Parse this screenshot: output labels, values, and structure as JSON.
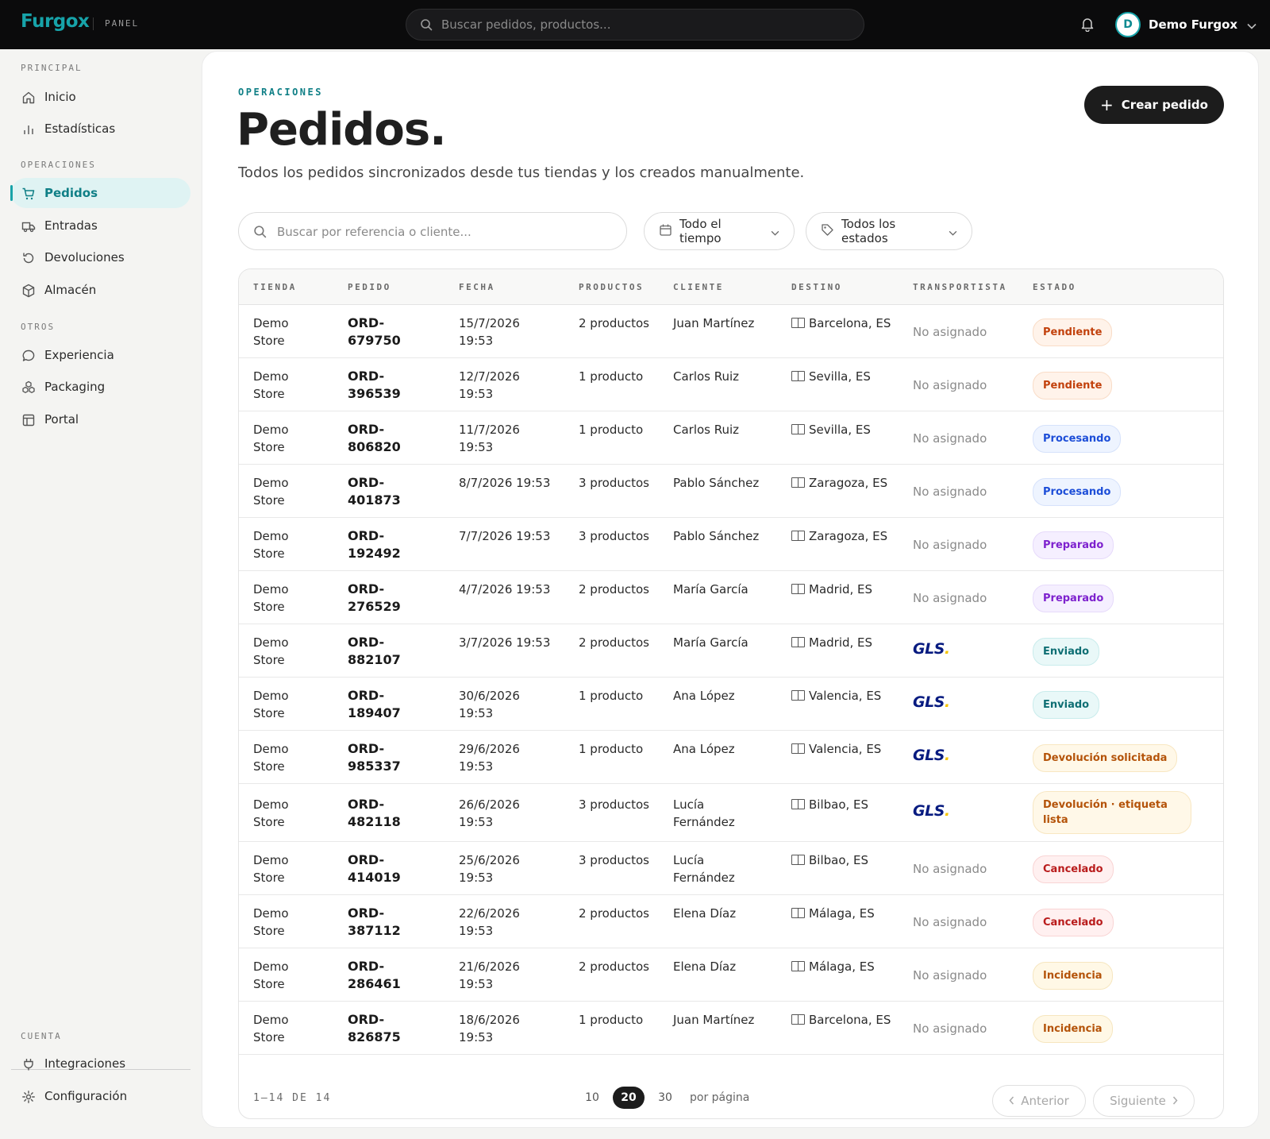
{
  "topbar": {
    "logo": "Furgox",
    "panel_label": "PANEL",
    "search_placeholder": "Buscar pedidos, productos...",
    "user_initial": "D",
    "user_name": "Demo Furgox"
  },
  "sidebar": {
    "sections": {
      "principal": "PRINCIPAL",
      "operaciones": "OPERACIONES",
      "otros": "OTROS",
      "cuenta": "CUENTA"
    },
    "items": [
      {
        "label": "Inicio",
        "icon": "home-icon"
      },
      {
        "label": "Estadísticas",
        "icon": "bar-chart-icon"
      },
      {
        "label": "Pedidos",
        "icon": "cart-icon",
        "active": true
      },
      {
        "label": "Entradas",
        "icon": "truck-icon"
      },
      {
        "label": "Devoluciones",
        "icon": "return-icon"
      },
      {
        "label": "Almacén",
        "icon": "box-icon"
      },
      {
        "label": "Experiencia",
        "icon": "chat-icon"
      },
      {
        "label": "Packaging",
        "icon": "boxes-icon"
      },
      {
        "label": "Portal",
        "icon": "layout-icon"
      },
      {
        "label": "Integraciones",
        "icon": "plug-icon"
      },
      {
        "label": "Configuración",
        "icon": "gear-icon"
      }
    ]
  },
  "page": {
    "eyebrow": "OPERACIONES",
    "title": "Pedidos.",
    "subtitle": "Todos los pedidos sincronizados desde tus tiendas y los creados manualmente.",
    "create_button": "Crear pedido"
  },
  "filters": {
    "search_placeholder": "Buscar por referencia o cliente...",
    "date_filter": "Todo el tiempo",
    "status_filter": "Todos los estados"
  },
  "table": {
    "headers": [
      "TIENDA",
      "PEDIDO",
      "FECHA",
      "PRODUCTOS",
      "CLIENTE",
      "DESTINO",
      "TRANSPORTISTA",
      "ESTADO"
    ],
    "rows": [
      {
        "store": "Demo Store",
        "order": "ORD-679750",
        "date": "15/7/2026 19:53",
        "products": "2 productos",
        "client": "Juan Martínez",
        "dest": "Barcelona, ES",
        "carrier": "No asignado",
        "status": "Pendiente",
        "status_kind": "pendiente"
      },
      {
        "store": "Demo Store",
        "order": "ORD-396539",
        "date": "12/7/2026 19:53",
        "products": "1 producto",
        "client": "Carlos Ruiz",
        "dest": "Sevilla, ES",
        "carrier": "No asignado",
        "status": "Pendiente",
        "status_kind": "pendiente"
      },
      {
        "store": "Demo Store",
        "order": "ORD-806820",
        "date": "11/7/2026 19:53",
        "products": "1 producto",
        "client": "Carlos Ruiz",
        "dest": "Sevilla, ES",
        "carrier": "No asignado",
        "status": "Procesando",
        "status_kind": "procesando"
      },
      {
        "store": "Demo Store",
        "order": "ORD-401873",
        "date": "8/7/2026 19:53",
        "products": "3 productos",
        "client": "Pablo Sánchez",
        "dest": "Zaragoza, ES",
        "carrier": "No asignado",
        "status": "Procesando",
        "status_kind": "procesando"
      },
      {
        "store": "Demo Store",
        "order": "ORD-192492",
        "date": "7/7/2026 19:53",
        "products": "3 productos",
        "client": "Pablo Sánchez",
        "dest": "Zaragoza, ES",
        "carrier": "No asignado",
        "status": "Preparado",
        "status_kind": "preparado"
      },
      {
        "store": "Demo Store",
        "order": "ORD-276529",
        "date": "4/7/2026 19:53",
        "products": "2 productos",
        "client": "María García",
        "dest": "Madrid, ES",
        "carrier": "No asignado",
        "status": "Preparado",
        "status_kind": "preparado"
      },
      {
        "store": "Demo Store",
        "order": "ORD-882107",
        "date": "3/7/2026 19:53",
        "products": "2 productos",
        "client": "María García",
        "dest": "Madrid, ES",
        "carrier": "GLS",
        "status": "Enviado",
        "status_kind": "enviado"
      },
      {
        "store": "Demo Store",
        "order": "ORD-189407",
        "date": "30/6/2026 19:53",
        "products": "1 producto",
        "client": "Ana López",
        "dest": "Valencia, ES",
        "carrier": "GLS",
        "status": "Enviado",
        "status_kind": "enviado"
      },
      {
        "store": "Demo Store",
        "order": "ORD-985337",
        "date": "29/6/2026 19:53",
        "products": "1 producto",
        "client": "Ana López",
        "dest": "Valencia, ES",
        "carrier": "GLS",
        "status": "Devolución solicitada",
        "status_kind": "devolucion"
      },
      {
        "store": "Demo Store",
        "order": "ORD-482118",
        "date": "26/6/2026 19:53",
        "products": "3 productos",
        "client": "Lucía Fernández",
        "dest": "Bilbao, ES",
        "carrier": "GLS",
        "status": "Devolución · etiqueta lista",
        "status_kind": "devolucion"
      },
      {
        "store": "Demo Store",
        "order": "ORD-414019",
        "date": "25/6/2026 19:53",
        "products": "3 productos",
        "client": "Lucía Fernández",
        "dest": "Bilbao, ES",
        "carrier": "No asignado",
        "status": "Cancelado",
        "status_kind": "cancelado"
      },
      {
        "store": "Demo Store",
        "order": "ORD-387112",
        "date": "22/6/2026 19:53",
        "products": "2 productos",
        "client": "Elena Díaz",
        "dest": "Málaga, ES",
        "carrier": "No asignado",
        "status": "Cancelado",
        "status_kind": "cancelado"
      },
      {
        "store": "Demo Store",
        "order": "ORD-286461",
        "date": "21/6/2026 19:53",
        "products": "2 productos",
        "client": "Elena Díaz",
        "dest": "Málaga, ES",
        "carrier": "No asignado",
        "status": "Incidencia",
        "status_kind": "incidencia"
      },
      {
        "store": "Demo Store",
        "order": "ORD-826875",
        "date": "18/6/2026 19:53",
        "products": "1 producto",
        "client": "Juan Martínez",
        "dest": "Barcelona, ES",
        "carrier": "No asignado",
        "status": "Incidencia",
        "status_kind": "incidencia"
      }
    ]
  },
  "pagination": {
    "range": "1–14 DE 14",
    "page_sizes": [
      "10",
      "20",
      "30"
    ],
    "selected_page_size": "20",
    "per_page_label": "por página",
    "prev": "Anterior",
    "next": "Siguiente"
  },
  "colors": {
    "accent": "#17a3a9",
    "topbar": "#0b0b0c",
    "gls_blue": "#071b80",
    "gls_yellow": "#f5c400"
  }
}
